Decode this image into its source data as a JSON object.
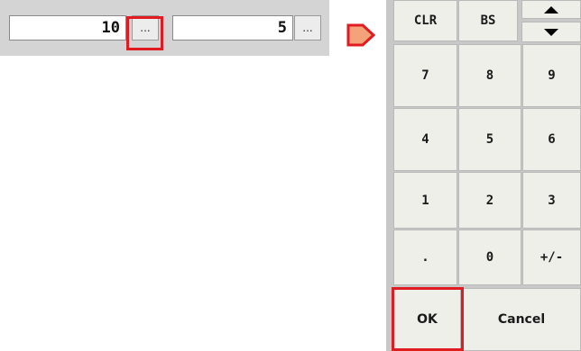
{
  "fields": [
    {
      "value": "10",
      "button_label": "..."
    },
    {
      "value": "5",
      "button_label": "..."
    }
  ],
  "keypad": {
    "row0": {
      "clr": "CLR",
      "bs": "BS",
      "up_icon": "triangle-up-icon",
      "down_icon": "triangle-down-icon"
    },
    "digits": [
      [
        "7",
        "8",
        "9"
      ],
      [
        "4",
        "5",
        "6"
      ],
      [
        "1",
        "2",
        "3"
      ],
      [
        ".",
        "0",
        "+/-"
      ]
    ],
    "ok": "OK",
    "cancel": "Cancel"
  },
  "colors": {
    "highlight": "#e01c22",
    "arrow_fill": "#f4a27a",
    "arrow_stroke": "#e01c22"
  }
}
